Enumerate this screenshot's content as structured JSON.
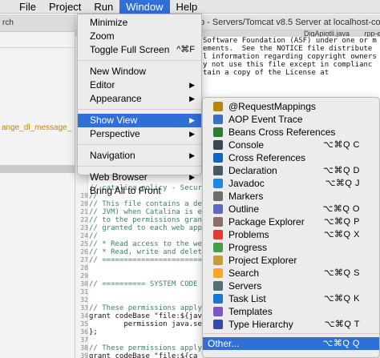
{
  "menubar": {
    "items": [
      {
        "label": "File"
      },
      {
        "label": "Project"
      },
      {
        "label": "Run"
      },
      {
        "label": "Window"
      },
      {
        "label": "Help"
      }
    ]
  },
  "background": {
    "title_fragment": "p - Servers/Tomcat v8.5 Server at localhost-co",
    "editor_tabs": [
      "DigApiotli.java",
      "rpp-external-we"
    ],
    "left_label": "ange_dl_message_",
    "left_tab": "rch"
  },
  "code": {
    "header_lines": [
      "Software Foundation (ASF) under one or m",
      "ements.  See the NOTICE file distribute",
      "l information regarding copyright owners",
      "y not use this file except in complianc",
      "tain a copy of the License at"
    ],
    "lines": [
      {
        "n": "",
        "t": "// catalina.policy - Secur"
      },
      {
        "n": "19",
        "t": "//"
      },
      {
        "n": "20",
        "t": "// This file contains a de"
      },
      {
        "n": "21",
        "t": "// JVM) when Catalina is e"
      },
      {
        "n": "22",
        "t": "// to the permissions gran"
      },
      {
        "n": "23",
        "t": "// granted to each web app"
      },
      {
        "n": "24",
        "t": "//"
      },
      {
        "n": "25",
        "t": "// * Read access to the we"
      },
      {
        "n": "26",
        "t": "// * Read, write and delet"
      },
      {
        "n": "27",
        "t": "// ========================"
      },
      {
        "n": "28",
        "t": ""
      },
      {
        "n": "29",
        "t": ""
      },
      {
        "n": "30",
        "t": "// ========== SYSTEM CODE"
      },
      {
        "n": "31",
        "t": ""
      },
      {
        "n": "32",
        "t": ""
      },
      {
        "n": "33",
        "t": "// These permissions apply"
      },
      {
        "n": "34",
        "t": "grant codeBase \"file:${jav"
      },
      {
        "n": "35",
        "t": "        permission java.se"
      },
      {
        "n": "36",
        "t": "};"
      },
      {
        "n": "37",
        "t": ""
      },
      {
        "n": "38",
        "t": "// These permissions apply"
      },
      {
        "n": "39",
        "t": "grant codeBase \"file:${ca"
      }
    ],
    "right_fragments": [
      "tf",
      "Ir",
      "in",
      "nt"
    ]
  },
  "window_menu": {
    "minimize": "Minimize",
    "zoom": "Zoom",
    "fullscreen": "Toggle Full Screen",
    "fullscreen_shortcut": "^⌘F",
    "new_window": "New Window",
    "editor": "Editor",
    "appearance": "Appearance",
    "show_view": "Show View",
    "perspective": "Perspective",
    "navigation": "Navigation",
    "web_browser": "Web Browser",
    "bring_all": "Bring All to Front",
    "arrow": "▶"
  },
  "show_view_menu": {
    "items": [
      {
        "label": "@RequestMappings",
        "shortcut": "",
        "icon": "request-mappings-icon",
        "color": "#b8860b"
      },
      {
        "label": "AOP Event Trace",
        "shortcut": "",
        "icon": "aop-event-trace-icon",
        "color": "#3a6fc4"
      },
      {
        "label": "Beans Cross References",
        "shortcut": "",
        "icon": "beans-cross-references-icon",
        "color": "#2e7d32"
      },
      {
        "label": "Console",
        "shortcut": "⌥⌘Q C",
        "icon": "console-icon",
        "color": "#37474f"
      },
      {
        "label": "Cross References",
        "shortcut": "",
        "icon": "cross-references-icon",
        "color": "#1565c0"
      },
      {
        "label": "Declaration",
        "shortcut": "⌥⌘Q D",
        "icon": "declaration-icon",
        "color": "#455a64"
      },
      {
        "label": "Javadoc",
        "shortcut": "⌥⌘Q J",
        "icon": "javadoc-icon",
        "color": "#1e88e5"
      },
      {
        "label": "Markers",
        "shortcut": "",
        "icon": "markers-icon",
        "color": "#6d6d6d"
      },
      {
        "label": "Outline",
        "shortcut": "⌥⌘Q O",
        "icon": "outline-icon",
        "color": "#5c6bc0"
      },
      {
        "label": "Package Explorer",
        "shortcut": "⌥⌘Q P",
        "icon": "package-explorer-icon",
        "color": "#8d6e63"
      },
      {
        "label": "Problems",
        "shortcut": "⌥⌘Q X",
        "icon": "problems-icon",
        "color": "#e53935"
      },
      {
        "label": "Progress",
        "shortcut": "",
        "icon": "progress-icon",
        "color": "#43a047"
      },
      {
        "label": "Project Explorer",
        "shortcut": "",
        "icon": "project-explorer-icon",
        "color": "#c79a3b"
      },
      {
        "label": "Search",
        "shortcut": "⌥⌘Q S",
        "icon": "search-icon",
        "color": "#f9a825"
      },
      {
        "label": "Servers",
        "shortcut": "",
        "icon": "servers-icon",
        "color": "#546e7a"
      },
      {
        "label": "Task List",
        "shortcut": "⌥⌘Q K",
        "icon": "task-list-icon",
        "color": "#1976d2"
      },
      {
        "label": "Templates",
        "shortcut": "",
        "icon": "templates-icon",
        "color": "#7e57c2"
      },
      {
        "label": "Type Hierarchy",
        "shortcut": "⌥⌘Q T",
        "icon": "type-hierarchy-icon",
        "color": "#3949ab"
      }
    ],
    "other": {
      "label": "Other...",
      "shortcut": "⌥⌘Q Q"
    }
  }
}
